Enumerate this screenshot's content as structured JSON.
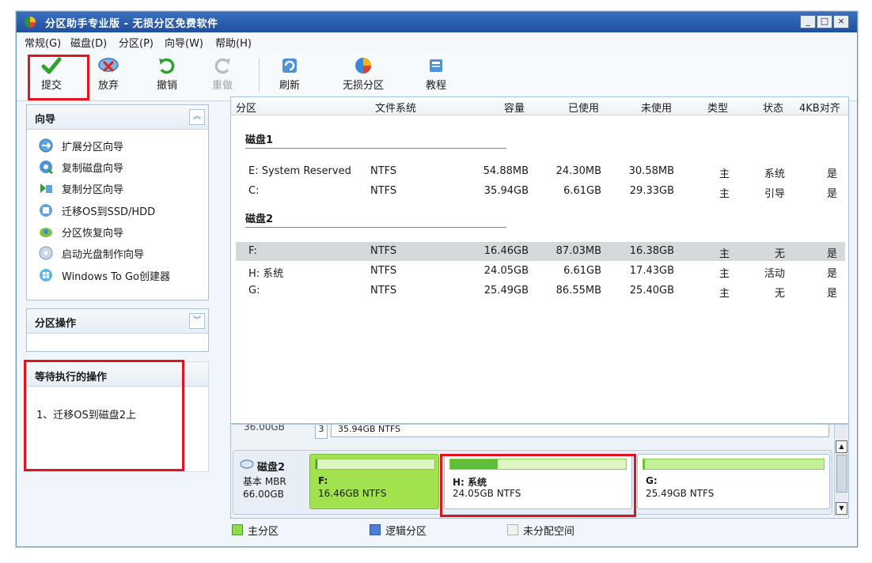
{
  "window": {
    "title": "分区助手专业版 - 无损分区免费软件"
  },
  "window_buttons": {
    "minimize": "_",
    "maximize": "□",
    "close": "×"
  },
  "menu": [
    "常规(G)",
    "磁盘(D)",
    "分区(P)",
    "向导(W)",
    "帮助(H)"
  ],
  "toolbar": {
    "commit": "提交",
    "discard": "放弃",
    "undo": "撤销",
    "redo": "重做",
    "refresh": "刷新",
    "lossless": "无损分区",
    "tutorial": "教程"
  },
  "wizard_panel": {
    "title": "向导",
    "items": [
      "扩展分区向导",
      "复制磁盘向导",
      "复制分区向导",
      "迁移OS到SSD/HDD",
      "分区恢复向导",
      "启动光盘制作向导",
      "Windows To Go创建器"
    ]
  },
  "ops_panel": {
    "title": "分区操作"
  },
  "pending_panel": {
    "title": "等待执行的操作",
    "items": [
      "1、迁移OS到磁盘2上"
    ]
  },
  "grid": {
    "headers": [
      "分区",
      "文件系统",
      "容量",
      "已使用",
      "未使用",
      "类型",
      "状态",
      "4KB对齐"
    ],
    "disk1_label": "磁盘1",
    "disk1_rows": [
      {
        "name": "E: System Reserved",
        "fs": "NTFS",
        "cap": "54.88MB",
        "used": "24.30MB",
        "free": "30.58MB",
        "type": "主",
        "status": "系统",
        "align": "是"
      },
      {
        "name": "C:",
        "fs": "NTFS",
        "cap": "35.94GB",
        "used": "6.61GB",
        "free": "29.33GB",
        "type": "主",
        "status": "引导",
        "align": "是"
      }
    ],
    "disk2_label": "磁盘2",
    "disk2_rows": [
      {
        "name": "F:",
        "fs": "NTFS",
        "cap": "16.46GB",
        "used": "87.03MB",
        "free": "16.38GB",
        "type": "主",
        "status": "无",
        "align": "是"
      },
      {
        "name": "H: 系统",
        "fs": "NTFS",
        "cap": "24.05GB",
        "used": "6.61GB",
        "free": "17.43GB",
        "type": "主",
        "status": "活动",
        "align": "是"
      },
      {
        "name": "G:",
        "fs": "NTFS",
        "cap": "25.49GB",
        "used": "86.55MB",
        "free": "25.40GB",
        "type": "主",
        "status": "无",
        "align": "是"
      }
    ]
  },
  "diskmap": {
    "disk1_partial": {
      "size": "36.00GB",
      "num": "3",
      "text": "35.94GB NTFS"
    },
    "disk2": {
      "name": "磁盘2",
      "type": "基本 MBR",
      "size": "66.00GB"
    },
    "partitions": [
      {
        "label": "F:",
        "detail": "16.46GB NTFS",
        "fill": 0.01
      },
      {
        "label": "H: 系统",
        "detail": "24.05GB NTFS",
        "fill": 0.27
      },
      {
        "label": "G:",
        "detail": "25.49GB NTFS",
        "fill": 0.01
      }
    ]
  },
  "legend": {
    "primary": "主分区",
    "logical": "逻辑分区",
    "unallocated": "未分配空间"
  },
  "colors": {
    "selected_row": "#d4d9dc",
    "partition_green": "#a3e24f",
    "highlight_red": "#e3141f",
    "title_blue": "#2a5cae"
  }
}
